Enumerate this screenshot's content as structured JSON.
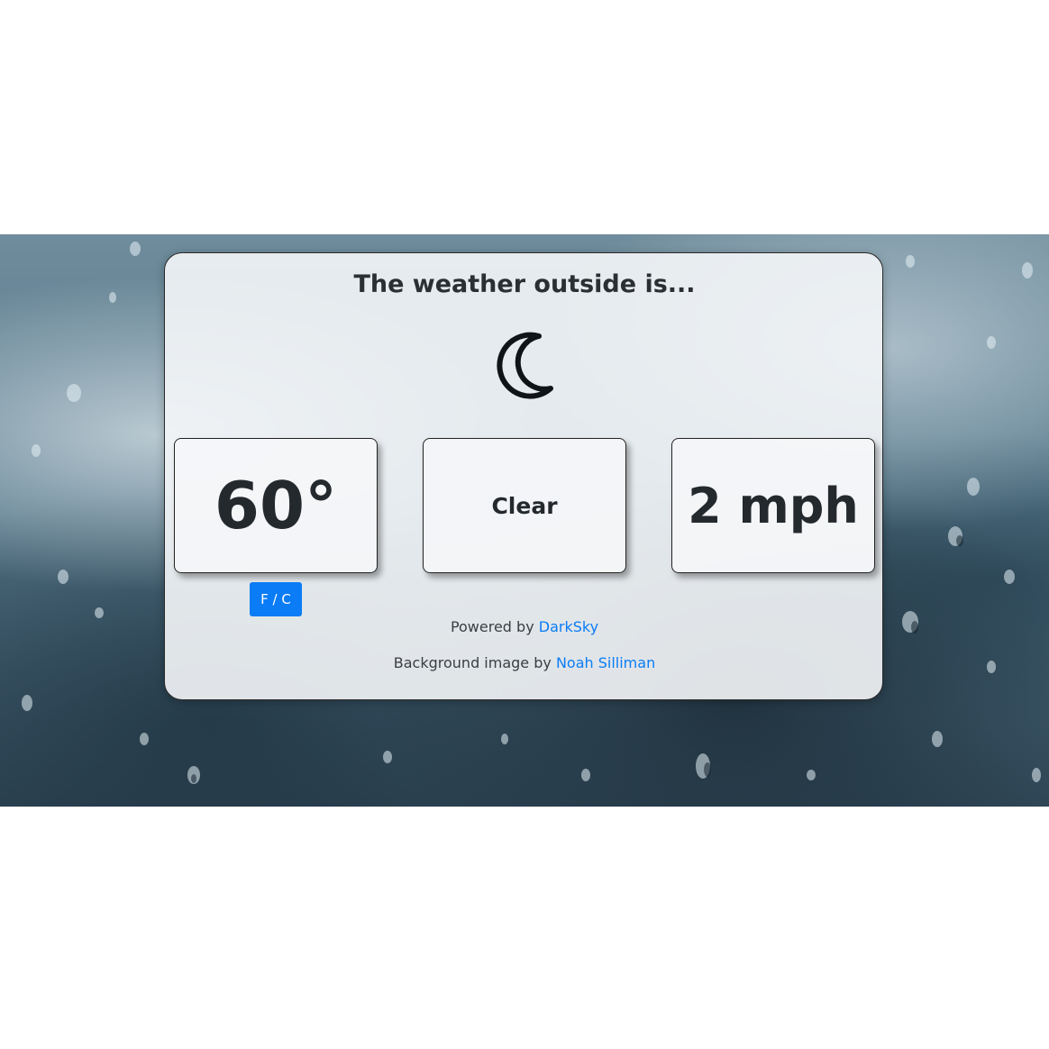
{
  "header": {
    "title": "The weather outside is..."
  },
  "weather": {
    "icon": "moon-icon",
    "temperature": "60°",
    "condition": "Clear",
    "wind": "2 mph"
  },
  "controls": {
    "unit_toggle_label": "F / C"
  },
  "footer": {
    "powered_prefix": "Powered by",
    "powered_link": "DarkSky",
    "background_prefix": "Background image by",
    "background_link": "Noah Silliman"
  },
  "colors": {
    "accent": "#0a7cf5",
    "text": "#24292e"
  }
}
